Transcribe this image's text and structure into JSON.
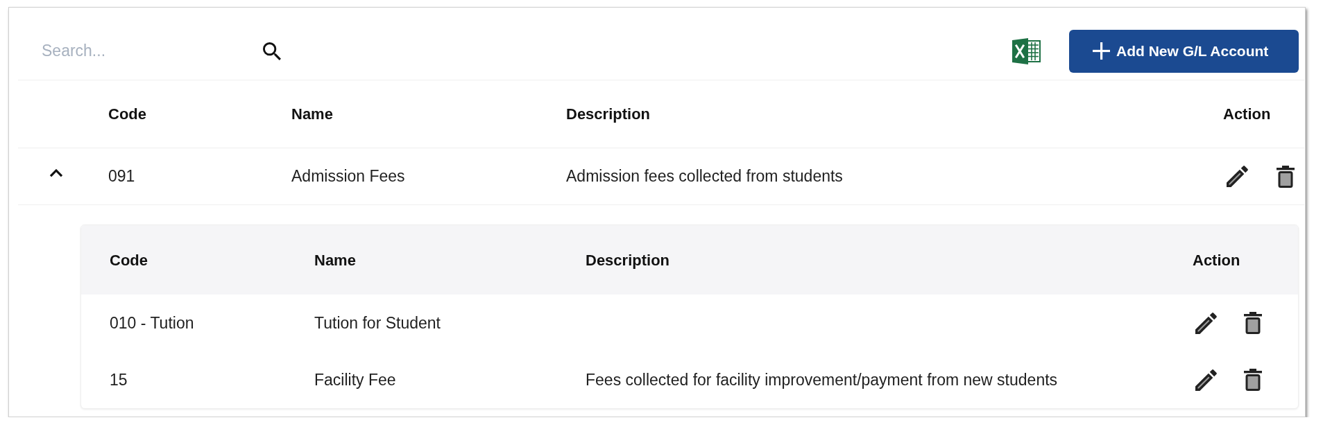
{
  "toolbar": {
    "search": {
      "placeholder": "Search..."
    },
    "add_button": {
      "label": "Add New G/L Account"
    }
  },
  "table": {
    "columns": [
      "Code",
      "Name",
      "Description",
      "Action"
    ],
    "rows": [
      {
        "code": "091",
        "name": "Admission Fees",
        "description": "Admission fees collected from students",
        "expanded": true,
        "sub_table": {
          "columns": [
            "Code",
            "Name",
            "Description",
            "Action"
          ],
          "rows": [
            {
              "code": "010 - Tution",
              "name": "Tution for Student"
            },
            {
              "code": "15",
              "name": "Facility Fee",
              "description": "Fees collected for facility improvement/payment from new students"
            }
          ]
        }
      }
    ]
  }
}
